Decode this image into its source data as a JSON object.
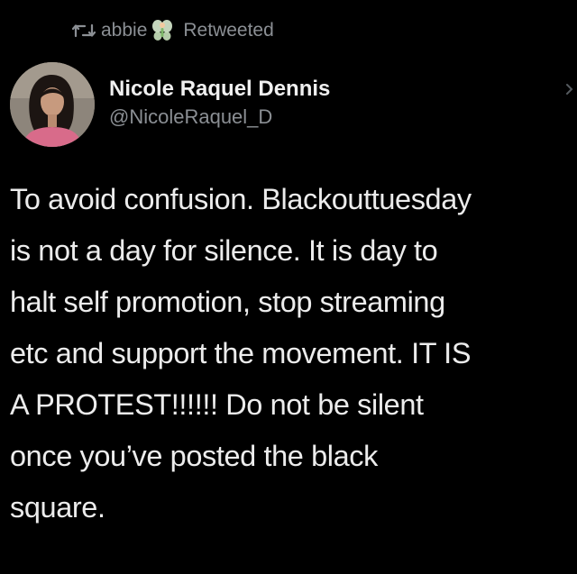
{
  "retweet": {
    "icon": "retweet-icon",
    "user": "abbie",
    "badge_icon": "fairy-emoji-icon",
    "label": "Retweeted"
  },
  "author": {
    "avatar_icon": "avatar-photo",
    "name": "Nicole Raquel Dennis",
    "handle": "@NicoleRaquel_D"
  },
  "menu_icon": "chevron-down-icon",
  "tweet": {
    "lines": [
      "To avoid confusion. Blackouttuesday",
      "is not a day for silence. It is day to",
      "halt self promotion, stop streaming",
      "etc and support the movement. IT IS",
      "A PROTEST!!!!!! Do not be silent",
      "once you’ve posted the black",
      "square."
    ]
  },
  "colors": {
    "background": "#000000",
    "text_primary": "#ececec",
    "text_secondary": "#8b8f94"
  }
}
